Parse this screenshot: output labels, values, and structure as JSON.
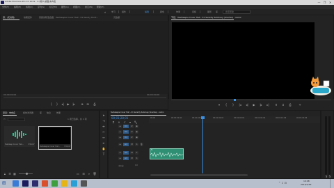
{
  "window": {
    "title": "Adobe Premiere Pro CC 2019 - C:\\用户\\桌面\\未命名",
    "controls": [
      "—",
      "❐",
      "✕"
    ]
  },
  "menu": [
    "文件(F)",
    "编辑(E)",
    "剪辑(C)",
    "序列(S)",
    "标记(M)",
    "图形(G)",
    "视图(V)",
    "窗口(W)",
    "帮助(H)"
  ],
  "workspace": {
    "items": [
      "学习",
      "组件",
      "编辑",
      "颜色",
      "效果",
      "音频",
      "图形",
      "库"
    ],
    "active_index": 2,
    "search_placeholder": "搜索帮助"
  },
  "source_panel": {
    "tabs": [
      "源：(无剪辑)",
      "效果控件",
      "音频剪辑混合器：TeaSleepie Cover Hall - 01 Gaudy Hunt...",
      "元数据"
    ],
    "timecode_left": "00;00;00;00",
    "timecode_right": "00;00;00;00"
  },
  "program_panel": {
    "tab": "节目：TeaSleepie Cover Hall - 01 Seradly Subduey (Scertes) - remix",
    "timecode": "00;01;28;01",
    "fit_label": "适合",
    "quality_label": "完整",
    "duration": "00;03;56;07"
  },
  "project_panel": {
    "tabs": [
      "项目：未命名",
      "媒体浏览器",
      "库",
      "信息",
      "效果"
    ],
    "search_placeholder": "",
    "item_count": "1 项已选择，共 2 项",
    "items": [
      {
        "name": "TeaSleep Cover Hall...",
        "duration": "3:56:07"
      },
      {
        "name": "TeaSleepie Cover Hall...",
        "duration": "3:56:07"
      }
    ]
  },
  "timeline_panel": {
    "tab": "TeaSleepie Cover Hall - 01 Seradly Subduey (Scertes) - remix",
    "timecode": "00;01;28;01",
    "ruler": [
      "00;00",
      "00;00;32;00",
      "00;01;04;02",
      "00;01;36;02",
      "00;02;08;04",
      "00;02;40;04",
      "00;03;12;06",
      "00;03;44;06"
    ],
    "video_tracks": [
      "V3",
      "V2",
      "V1"
    ],
    "audio_tracks": [
      "A1",
      "A2",
      "A3"
    ],
    "master_label": "主声道",
    "master_value": "0.0"
  },
  "taskbar": {
    "time": "19:08",
    "date": "2019/1/29"
  },
  "colors": {
    "accent": "#3b8ee0",
    "audio_clip": "#2f8f73",
    "playhead": "#3b8ee0"
  }
}
